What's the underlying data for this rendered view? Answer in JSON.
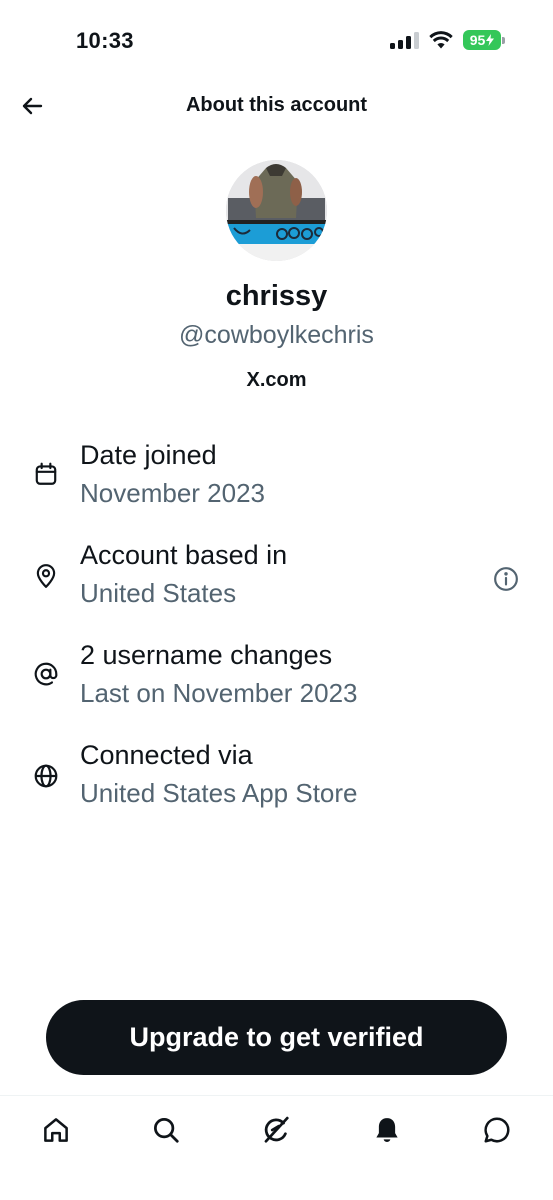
{
  "status_bar": {
    "time": "10:33",
    "battery": "95"
  },
  "header": {
    "title": "About this account"
  },
  "profile": {
    "display_name": "chrissy",
    "handle": "@cowboylkechris",
    "domain": "X.com"
  },
  "info": [
    {
      "icon": "calendar-icon",
      "title": "Date joined",
      "subtitle": "November 2023"
    },
    {
      "icon": "location-pin-icon",
      "title": "Account based in",
      "subtitle": "United States"
    },
    {
      "icon": "at-sign-icon",
      "title": "2 username changes",
      "subtitle": "Last on November 2023"
    },
    {
      "icon": "globe-icon",
      "title": "Connected via",
      "subtitle": "United States App Store"
    }
  ],
  "upgrade_label": "Upgrade to get verified",
  "tabs": [
    "home-icon",
    "search-icon",
    "grok-icon",
    "notifications-icon",
    "messages-icon"
  ],
  "colors": {
    "text": "#0f1419",
    "secondary": "#536471",
    "battery": "#34c759",
    "button": "#0f1419"
  }
}
